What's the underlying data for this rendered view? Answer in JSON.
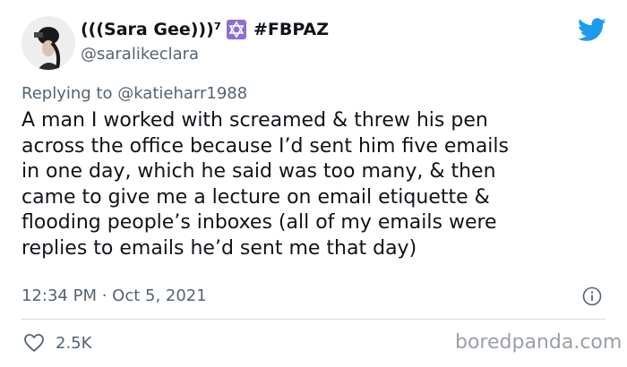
{
  "author": {
    "display_name": "(((Sara Gee)))⁷",
    "hashtag": "#FBPAZ",
    "handle": "@saralikeclara"
  },
  "reply": {
    "prefix": "Replying to ",
    "mention": "@katieharr1988"
  },
  "tweet": {
    "lines": [
      "A man I worked with screamed & threw his pen",
      "across the office because I’d sent him five emails",
      "in one day, which he said was too many, & then",
      "came to give me a lecture on email etiquette &",
      "flooding people’s inboxes (all of my emails were",
      "replies to emails he’d sent me that day)"
    ],
    "timestamp": "12:34 PM · Oct 5, 2021"
  },
  "stats": {
    "likes": "2.5K"
  },
  "watermark": "boredpanda.com",
  "icons": {
    "brand": "twitter-bird-icon",
    "flag": "star-of-david-icon",
    "info": "info-icon",
    "like": "heart-icon"
  },
  "colors": {
    "twitter_blue": "#1d9bf0",
    "secondary_text": "#536471",
    "primary_text": "#0f1419",
    "star_badge": "#8c6fd0",
    "divider": "#cfd9de",
    "watermark": "#9aa0a6"
  }
}
